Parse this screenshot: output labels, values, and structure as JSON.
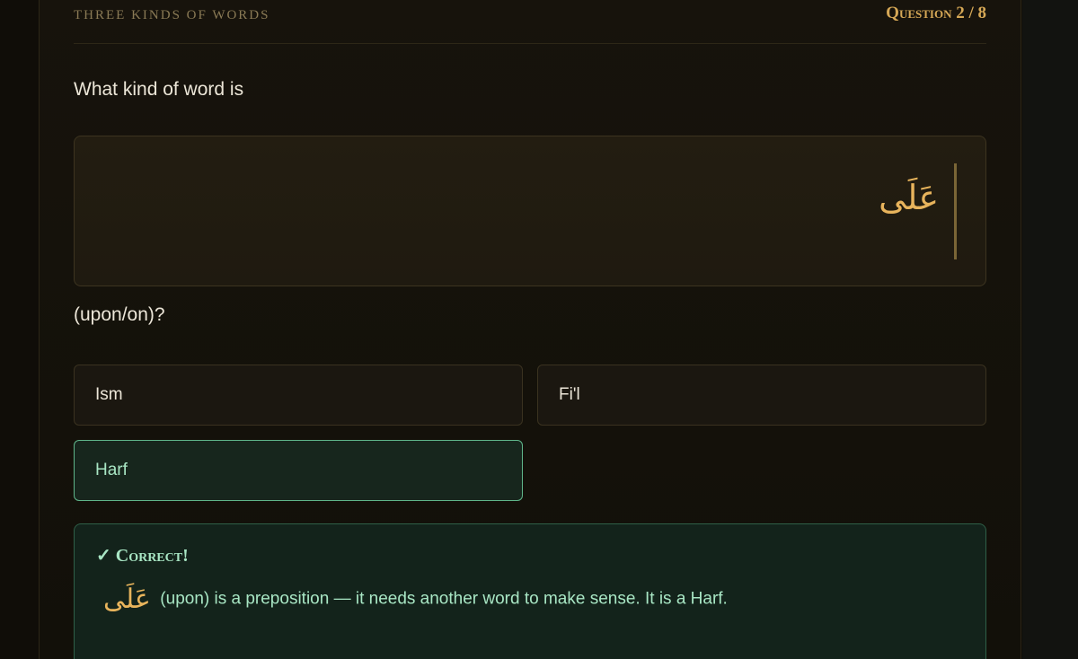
{
  "header": {
    "lesson_title": "Three Kinds of Words",
    "question_counter": "Question 2 / 8"
  },
  "question": {
    "prompt_before": "What kind of word is",
    "arabic_word": "عَلَى",
    "prompt_after": "(upon/on)?"
  },
  "options": [
    {
      "label": "Ism",
      "state": "default"
    },
    {
      "label": "Fi'l",
      "state": "default"
    },
    {
      "label": "Harf",
      "state": "selected-correct"
    }
  ],
  "feedback": {
    "title": "✓ Correct!",
    "arabic": "عَلَى",
    "text": "(upon) is a preposition — it needs another word to make sense. It is a Harf."
  },
  "colors": {
    "accent_gold": "#d6a856",
    "arabic_gold": "#e8b45c",
    "correct_green": "#a8e6c4",
    "correct_border": "#5fb58a"
  }
}
